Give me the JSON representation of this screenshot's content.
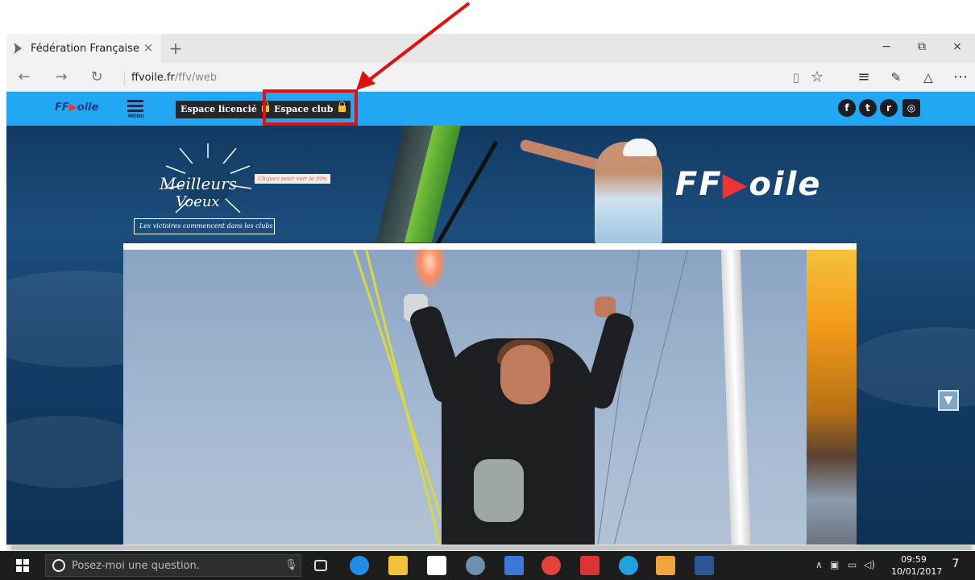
{
  "browser": {
    "tab_title": "Fédération Française de",
    "tab_close": "×",
    "new_tab": "+",
    "url_domain": "ffvoile.fr",
    "url_path": "/ffv/web",
    "window_controls": {
      "minimize": "−",
      "maximize": "⧉",
      "close": "×"
    }
  },
  "site": {
    "logo_prefix": "FF",
    "logo_suffix": "oile",
    "menu_label": "MENU",
    "espace_licencie": "Espace licencié",
    "espace_club": "Espace club",
    "social": {
      "facebook": "f",
      "twitter": "t",
      "rss": "r",
      "media": "◎"
    }
  },
  "hero": {
    "voeux_title": "Meilleurs",
    "voeux_subtitle": "Voeux",
    "voeux_ribbon": "Les victoires commencent dans les clubs",
    "voeux_click": "Cliquez pour voir le film",
    "logo_prefix": "FF",
    "logo_suffix": "oile"
  },
  "taskbar": {
    "search_placeholder": "Posez-moi une question.",
    "time": "09:59",
    "date": "10/01/2017",
    "notifications": "7"
  },
  "colors": {
    "site_header": "#22a8f2",
    "annotation_red": "#e01010",
    "espace_button": "#24272c"
  }
}
